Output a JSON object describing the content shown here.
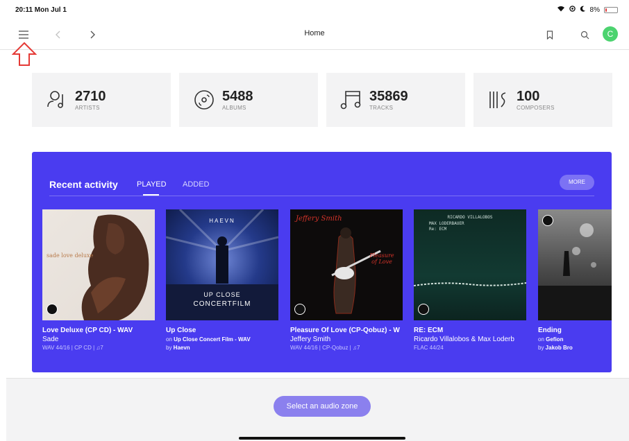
{
  "status_bar": {
    "time": "20:11  Mon Jul 1",
    "battery": "8%",
    "battery_level": 0.08
  },
  "nav": {
    "title": "Home",
    "avatar_letter": "C",
    "icons": [
      "menu-icon",
      "back-icon",
      "forward-icon",
      "bookmark-icon",
      "search-icon"
    ]
  },
  "stats": [
    {
      "number": "2710",
      "label": "ARTISTS",
      "icon": "artist-icon"
    },
    {
      "number": "5488",
      "label": "ALBUMS",
      "icon": "album-icon"
    },
    {
      "number": "35869",
      "label": "TRACKS",
      "icon": "track-icon"
    },
    {
      "number": "100",
      "label": "COMPOSERS",
      "icon": "composer-icon"
    }
  ],
  "activity": {
    "title": "Recent activity",
    "tabs": [
      "PLAYED",
      "ADDED"
    ],
    "active_tab": "PLAYED",
    "more": "MORE",
    "albums": [
      {
        "title": "Love Deluxe (CP CD) - WAV",
        "artist": "Sade",
        "meta": "WAV 44/16 | CP CD | ♫7",
        "cover_text": "sade love deluxe"
      },
      {
        "title": "Up Close",
        "on_prefix": "on ",
        "on_value": "Up Close Concert Film - WAV",
        "by_prefix": "by ",
        "by_value": "Haevn",
        "cover_text_top": "HAEVN",
        "cover_text_1": "UP CLOSE",
        "cover_text_2": "CONCERTFILM"
      },
      {
        "title": "Pleasure Of Love (CP-Qobuz) - W",
        "artist": "Jeffery Smith",
        "meta": "WAV 44/16 | CP-Qobuz | ♫7",
        "cover_text_top": "Jeffery Smith",
        "cover_text_side": "Pleasure of Love"
      },
      {
        "title": "RE: ECM",
        "artist": "Ricardo Villalobos & Max Loderb",
        "meta": "FLAC 44/24",
        "cover_text_1": "RICARDO VILLALOBOS",
        "cover_text_2": "MAX LODERBAUER",
        "cover_text_3": "Re: ECM"
      },
      {
        "title": "Ending",
        "on_prefix": "on ",
        "on_value": "Gefion",
        "by_prefix": "by ",
        "by_value": "Jakob Bro"
      }
    ]
  },
  "bottom": {
    "zone_button": "Select an audio zone"
  },
  "colors": {
    "accent": "#4a3cf0",
    "zone_button": "#8b80ee",
    "avatar": "#4cd36f",
    "annotation_arrow": "#e53935"
  }
}
